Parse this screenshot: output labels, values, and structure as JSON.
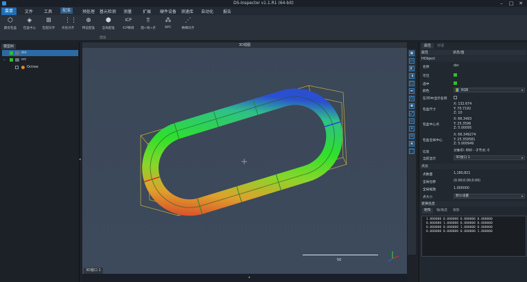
{
  "window": {
    "title": "DS-Inspector v1.1.R1 (64-bit)"
  },
  "menubar": {
    "main_button": "菜单",
    "items": [
      "文件",
      "工具",
      "配准",
      "预处理",
      "基元检测",
      "测量",
      "扩展",
      "硬件设备",
      "测速库",
      "自动化",
      "报告"
    ],
    "active_index": 2
  },
  "ribbon": {
    "buttons": [
      {
        "label": "最优包盒",
        "icon": "box-icon"
      },
      {
        "label": "包盒中心",
        "icon": "box-center-icon"
      },
      {
        "label": "匹配对齐",
        "icon": "match-align-icon"
      },
      {
        "label": "点名对齐",
        "icon": "point-align-icon"
      },
      {
        "label": "特征配准",
        "icon": "feature-registration-icon"
      },
      {
        "label": "全局配准",
        "icon": "global-registration-icon"
      },
      {
        "label": "ICP精调",
        "icon": "icp-icon"
      },
      {
        "label": "面+线+点",
        "icon": "plane-line-point-icon"
      },
      {
        "label": "NPC",
        "icon": "npc-icon"
      },
      {
        "label": "精细对齐",
        "icon": "fine-align-icon"
      }
    ],
    "group_label": "配准"
  },
  "left_panel": {
    "tab": "模型树",
    "tree": [
      {
        "label": "dst",
        "checked": true,
        "selected": true,
        "color": "#2fbf2f"
      },
      {
        "label": "src",
        "checked": true,
        "selected": false,
        "color": "#2fbf2f"
      },
      {
        "label": "Octree",
        "checked": false,
        "selected": false,
        "color": "#e08a2c"
      }
    ]
  },
  "viewport": {
    "title": "3D视图",
    "tab": "3D窗口 1",
    "scale_label": "50"
  },
  "right_panel": {
    "tabs": [
      "属性",
      "对话"
    ],
    "header": {
      "key": "属性",
      "value": "状态/值"
    },
    "section_object": "HObject",
    "props": [
      {
        "k": "名称",
        "v": "dst"
      },
      {
        "k": "可见",
        "v": "checkbox-on"
      },
      {
        "k": "选中",
        "v": "checkbox-on"
      },
      {
        "k": "颜色",
        "v": "RGB"
      },
      {
        "k": "在3D中显示名称",
        "v": "checkbox-off"
      },
      {
        "k": "包盒尺寸",
        "v": "X: 132.674\nY: 70.7192\nZ: 10"
      },
      {
        "k": "包盒中心点",
        "v": "X: 66.3493\nY: 25.3596\nZ: 5.00095"
      },
      {
        "k": "包盒全局中心",
        "v": "X: 66.349274\nY: 25.359581\nZ: 5.000949"
      },
      {
        "k": "信息",
        "v": "对象ID: 890 - 子节点: 0"
      },
      {
        "k": "当前显示",
        "v": "3D窗口 1"
      }
    ],
    "section_cloud": "点云",
    "cloud_props": [
      {
        "k": "点数量",
        "v": "1,180,821"
      },
      {
        "k": "全局位移",
        "v": "(0.00;0.00;0.00)"
      },
      {
        "k": "全局缩放",
        "v": "1.000000"
      },
      {
        "k": "点大小",
        "v": "默认设置"
      }
    ],
    "console_title": "变换信息",
    "console_tabs": [
      "矩阵",
      "轴/角度",
      "缩放"
    ],
    "console_text": "1.000000 0.000000 0.000000 0.000000\n0.000000 1.000000 0.000000 0.000000\n0.000000 0.000000 1.000000 0.000000\n0.000000 0.000000 0.000000 1.000000"
  },
  "colors": {
    "accent": "#1f6fb8",
    "selection": "#2b6aa6",
    "checkbox": "#2fbf2f"
  }
}
